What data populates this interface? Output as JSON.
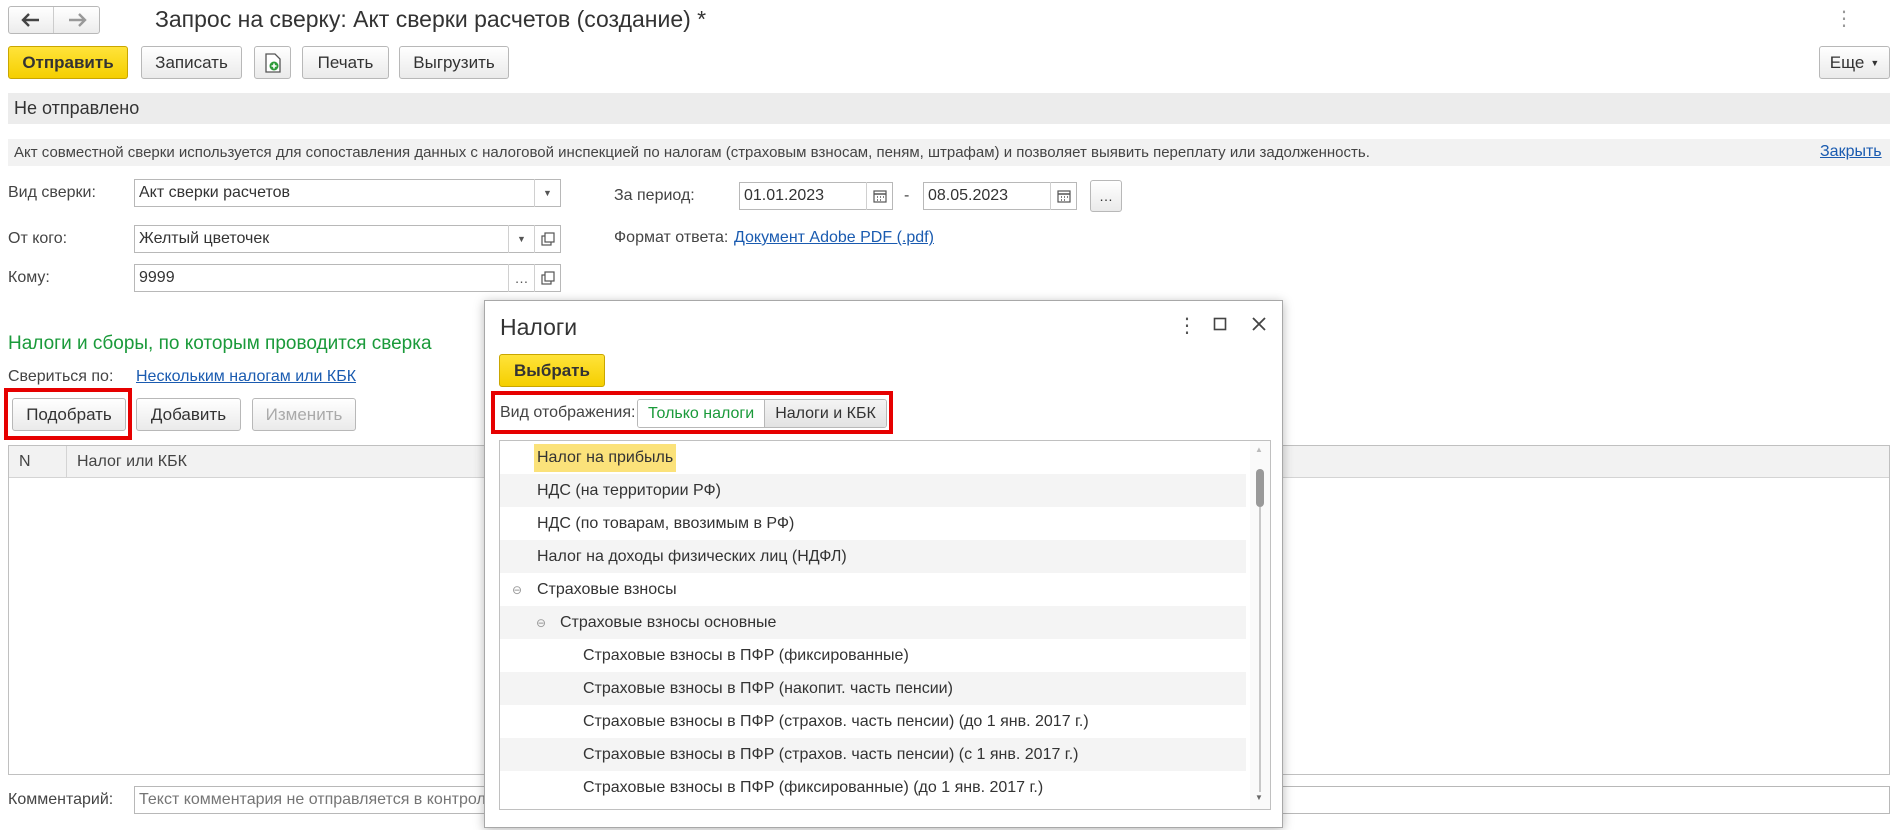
{
  "window": {
    "title": "Запрос на сверку: Акт сверки расчетов (создание) *",
    "more_glyph": "⋮"
  },
  "toolbar": {
    "send": "Отправить",
    "save": "Записать",
    "print": "Печать",
    "export": "Выгрузить",
    "more": "Еще"
  },
  "status": {
    "text": "Не отправлено"
  },
  "info": {
    "text": "Акт совместной сверки используется для сопоставления данных с налоговой инспекцией по налогам (страховым взносам, пеням, штрафам) и позволяет выявить переплату или задолженность.",
    "close": "Закрыть"
  },
  "form": {
    "kind_label": "Вид сверки:",
    "kind_value": "Акт сверки расчетов",
    "from_label": "От кого:",
    "from_value": "Желтый цветочек",
    "to_label": "Кому:",
    "to_value": "9999",
    "period_label": "За период:",
    "period_from": "01.01.2023",
    "period_sep": "-",
    "period_to": "08.05.2023",
    "format_label": "Формат ответа:",
    "format_value": "Документ Adobe PDF (.pdf)"
  },
  "taxes_section": {
    "title": "Налоги и сборы, по которым проводится сверка",
    "by_label": "Свериться по:",
    "by_value": "Нескольким налогам или КБК",
    "pick": "Подобрать",
    "add": "Добавить",
    "edit": "Изменить",
    "columns": [
      "N",
      "Налог или КБК"
    ]
  },
  "comment": {
    "label": "Комментарий:",
    "placeholder": "Текст комментария не отправляется в контроли"
  },
  "dialog": {
    "title": "Налоги",
    "select": "Выбрать",
    "view_label": "Вид отображения:",
    "view_options": [
      "Только налоги",
      "Налоги и КБК"
    ],
    "items": [
      {
        "label": "Налог на прибыль",
        "level": 0,
        "highlighted": true
      },
      {
        "label": "НДС (на территории РФ)",
        "level": 0
      },
      {
        "label": "НДС (по товарам, ввозимым в РФ)",
        "level": 0
      },
      {
        "label": "Налог на доходы физических лиц (НДФЛ)",
        "level": 0
      },
      {
        "label": "Страховые взносы",
        "level": 0,
        "group": true
      },
      {
        "label": "Страховые взносы основные",
        "level": 1,
        "group": true
      },
      {
        "label": "Страховые взносы в ПФР  (фиксированные)",
        "level": 2
      },
      {
        "label": "Страховые взносы в ПФР (накопит. часть пенсии)",
        "level": 2
      },
      {
        "label": "Страховые взносы в ПФР (страхов. часть пенсии) (до 1 янв. 2017 г.)",
        "level": 2
      },
      {
        "label": "Страховые взносы в ПФР (страхов. часть пенсии) (с 1 янв. 2017 г.)",
        "level": 2
      },
      {
        "label": "Страховые взносы в ПФР (фиксированные) (до 1 янв. 2017 г.)",
        "level": 2
      }
    ]
  }
}
